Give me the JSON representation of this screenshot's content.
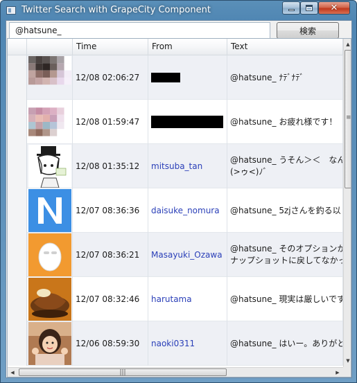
{
  "window": {
    "title": "Twitter Search with GrapeCity Component",
    "minimize_icon": "minimize-icon",
    "maximize_icon": "maximize-icon",
    "close_icon": "close-icon"
  },
  "search": {
    "value": "@hatsune_",
    "button_label": "検索"
  },
  "grid": {
    "columns": [
      "",
      "",
      "Time",
      "From",
      "Text"
    ],
    "rows": [
      {
        "time": "12/08 02:06:27",
        "from": "",
        "from_redacted": true,
        "text": "@hatsune_ ﾅﾃﾞﾅﾃﾞ",
        "avatar": "pixelated"
      },
      {
        "time": "12/08 01:59:47",
        "from": "",
        "from_redacted": true,
        "text": "@hatsune_ お疲れ様です！",
        "avatar": "pixelated2"
      },
      {
        "time": "12/08 01:35:12",
        "from": "mitsuba_tan",
        "text": "@hatsune_ うそん＞＜　なん",
        "text2": "(>ゥ<)ﾉﾞ",
        "avatar": "sketch"
      },
      {
        "time": "12/07 08:36:36",
        "from": "daisuke_nomura",
        "text": "@hatsune_ 5zjさんを釣る以",
        "avatar": "letter-n"
      },
      {
        "time": "12/07 08:36:21",
        "from": "Masayuki_Ozawa",
        "text": "@hatsune_ そのオプションか",
        "text2": "ナップショットに戻してなかっ",
        "avatar": "egg"
      },
      {
        "time": "12/07 08:32:46",
        "from": "harutama",
        "text": "@hatsune_ 現実は厳しいです",
        "avatar": "food"
      },
      {
        "time": "12/06 08:59:30",
        "from": "naoki0311",
        "text": "@hatsune_ はいー。ありがと",
        "avatar": "photo"
      }
    ]
  },
  "scrollbar": {
    "h_grip": "|||",
    "v_grip": "≡"
  },
  "colors": {
    "link": "#2a3fb8",
    "row_alt": "#eef0f5",
    "title_bar": "#4f86b3"
  }
}
